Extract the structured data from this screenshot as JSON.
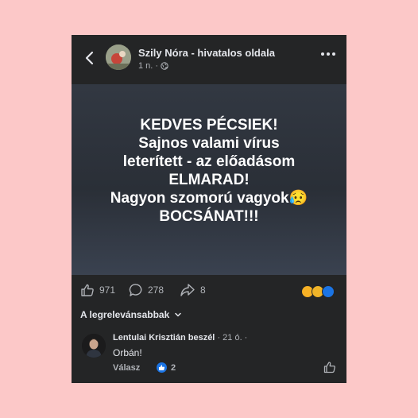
{
  "post": {
    "page_name": "Szily Nóra - hivatalos oldala",
    "time": "1 n.",
    "time_sep": "·",
    "image_text": [
      "KEDVES PÉCSIEK!",
      "Sajnos valami vírus",
      "leterített - az előadásom",
      "ELMARAD!",
      "Nagyon szomorú vagyok😥",
      "BOCSÁNAT!!!"
    ],
    "likes": "971",
    "comments": "278",
    "shares": "8"
  },
  "sort_label": "A legrelevánsabbak",
  "comment": {
    "author": "Lentulai Krisztián beszél",
    "time": "· 21 ó. ·",
    "text": "Orbán!",
    "reply_label": "Válasz",
    "like_count": "2"
  },
  "icons": {
    "back": "chevron-left-icon",
    "more": "more-dots-icon",
    "globe": "globe-icon",
    "like": "thumbs-up-icon",
    "comment": "comment-bubble-icon",
    "share": "share-arrow-icon",
    "sort": "chevron-down-icon"
  },
  "colors": {
    "background": "#fcc8c8",
    "card": "#242526",
    "text": "#e4e6eb",
    "muted": "#b0b3b8",
    "like_blue": "#1b74e4"
  }
}
